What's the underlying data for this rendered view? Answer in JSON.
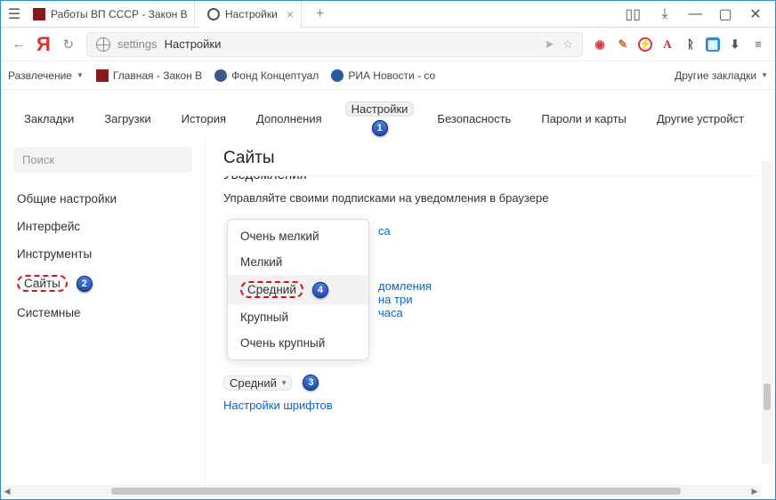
{
  "titlebar": {
    "tabs": [
      {
        "title": "Работы ВП СССР - Закон В"
      },
      {
        "title": "Настройки"
      }
    ]
  },
  "addressbar": {
    "path": "settings",
    "title": "Настройки"
  },
  "ext_icons": {
    "a_letter": "A"
  },
  "bookmarks": {
    "entertainment": "Развлечение",
    "main_law": "Главная - Закон В",
    "fund": "Фонд Концептуал",
    "ria": "РИА Новости - со",
    "other": "Другие закладки"
  },
  "tabs_nav": {
    "bookmarks": "Закладки",
    "downloads": "Загрузки",
    "history": "История",
    "addons": "Дополнения",
    "settings": "Настройки",
    "security": "Безопасность",
    "passwords": "Пароли и карты",
    "devices": "Другие устройст"
  },
  "sidebar": {
    "search_placeholder": "Поиск",
    "items": {
      "general": "Общие настройки",
      "interface": "Интерфейс",
      "tools": "Инструменты",
      "sites": "Сайты",
      "system": "Системные"
    }
  },
  "main": {
    "heading": "Сайты",
    "subheading_cut": "Уведомления",
    "desc": "Управляйте своими подписками на уведомления в браузере",
    "partial_link_1": "са",
    "partial_link_2": "домления на три часа",
    "dropdown": {
      "opt1": "Очень мелкий",
      "opt2": "Мелкий",
      "opt3": "Средний",
      "opt4": "Крупный",
      "opt5": "Очень крупный"
    },
    "dd_button": "Средний",
    "fonts_link": "Настройки шрифтов"
  },
  "badges": {
    "b1": "1",
    "b2": "2",
    "b3": "3",
    "b4": "4"
  }
}
